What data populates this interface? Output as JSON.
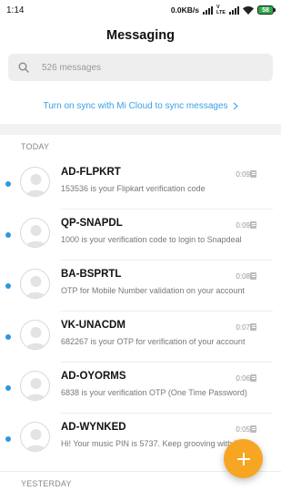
{
  "status_bar": {
    "time": "1:14",
    "net_speed": "0.0KB/s",
    "battery_level": "58",
    "battery_color": "#2ea84b"
  },
  "header": {
    "title": "Messaging"
  },
  "search": {
    "placeholder": "526 messages",
    "icon": "search-icon"
  },
  "sync_banner": {
    "text": "Turn on sync with Mi Cloud to sync messages",
    "icon": "chevron-right-icon"
  },
  "sections": {
    "today": "TODAY",
    "yesterday": "YESTERDAY"
  },
  "conversations": [
    {
      "sender": "AD-FLPKRT",
      "preview": "153536 is your Flipkart verification code",
      "time": "0:09"
    },
    {
      "sender": "QP-SNAPDL",
      "preview": "1000 is your verification code to login to Snapdeal",
      "time": "0:09"
    },
    {
      "sender": "BA-BSPRTL",
      "preview": "OTP for Mobile Number validation on your account",
      "time": "0:08"
    },
    {
      "sender": "VK-UNACDM",
      "preview": "682267 is your OTP for verification of your account",
      "time": "0:07"
    },
    {
      "sender": "AD-OYORMS",
      "preview": "6838 is your verification OTP (One Time Password)",
      "time": "0:06"
    },
    {
      "sender": "AD-WYNKED",
      "preview": "Hi! Your music PIN is 5737. Keep grooving with Wynk",
      "time": "0:05"
    }
  ],
  "colors": {
    "accent": "#3aa0e6",
    "unread_dot": "#2f96e0",
    "fab": "#f6a623"
  },
  "fab": {
    "icon": "plus-icon"
  }
}
